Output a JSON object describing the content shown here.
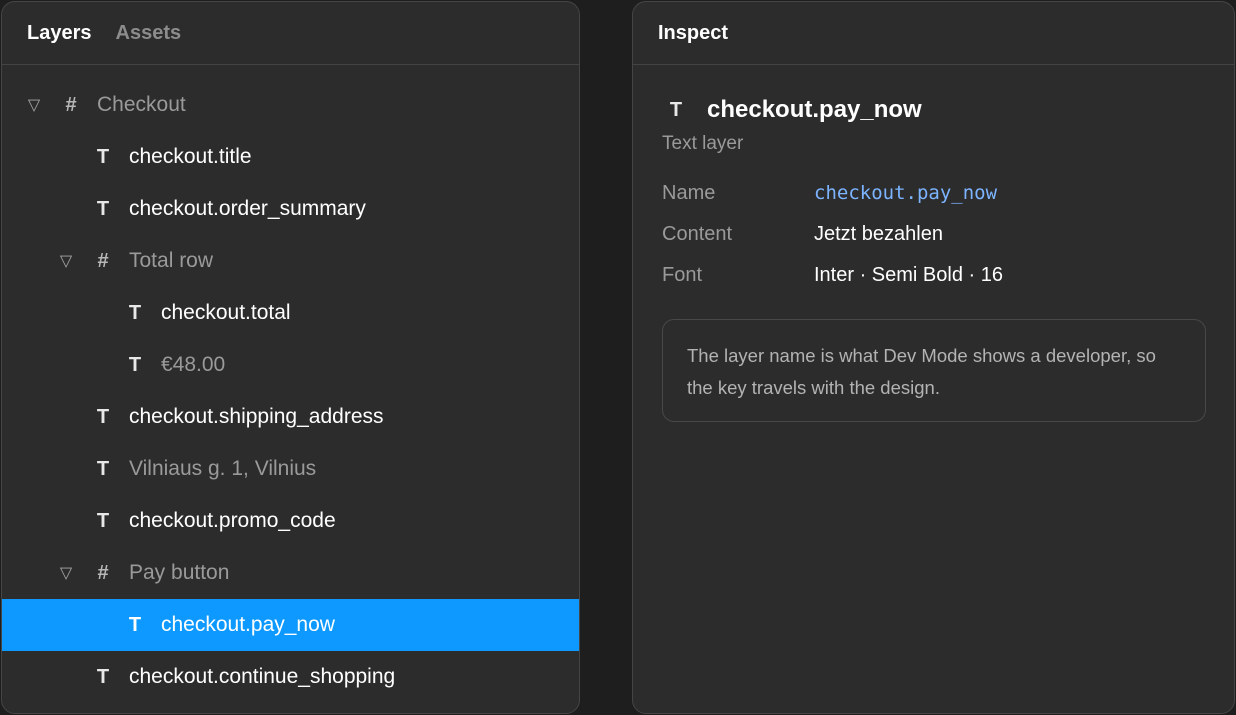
{
  "layers_panel": {
    "tabs": [
      {
        "label": "Layers",
        "active": true
      },
      {
        "label": "Assets",
        "active": false
      }
    ],
    "tree": [
      {
        "type": "frame",
        "label": "Checkout",
        "depth": 0,
        "expanded": true,
        "style": "muted"
      },
      {
        "type": "text",
        "label": "checkout.title",
        "depth": 1,
        "style": "key"
      },
      {
        "type": "text",
        "label": "checkout.order_summary",
        "depth": 1,
        "style": "key"
      },
      {
        "type": "frame",
        "label": "Total row",
        "depth": 1,
        "expanded": true,
        "style": "muted"
      },
      {
        "type": "text",
        "label": "checkout.total",
        "depth": 2,
        "style": "key"
      },
      {
        "type": "text",
        "label": "€48.00",
        "depth": 2,
        "style": "muted"
      },
      {
        "type": "text",
        "label": "checkout.shipping_address",
        "depth": 1,
        "style": "key"
      },
      {
        "type": "text",
        "label": "Vilniaus g. 1, Vilnius",
        "depth": 1,
        "style": "muted"
      },
      {
        "type": "text",
        "label": "checkout.promo_code",
        "depth": 1,
        "style": "key"
      },
      {
        "type": "frame",
        "label": "Pay button",
        "depth": 1,
        "expanded": true,
        "style": "muted"
      },
      {
        "type": "text",
        "label": "checkout.pay_now",
        "depth": 2,
        "style": "key",
        "selected": true
      },
      {
        "type": "text",
        "label": "checkout.continue_shopping",
        "depth": 1,
        "style": "key"
      }
    ]
  },
  "inspect_panel": {
    "title": "Inspect",
    "layer_type_glyph": "T",
    "layer_name": "checkout.pay_now",
    "layer_kind": "Text layer",
    "properties": [
      {
        "label": "Name",
        "value": "checkout.pay_now",
        "mono": true
      },
      {
        "label": "Content",
        "value": "Jetzt bezahlen",
        "mono": false
      },
      {
        "label": "Font",
        "value": "Inter · Semi Bold · 16",
        "mono": false
      }
    ],
    "note": "The layer name is what Dev Mode shows a developer, so the key travels with the design."
  },
  "glyphs": {
    "caret": "▽",
    "frame": "#",
    "text": "T"
  },
  "colors": {
    "selection": "#0d99ff",
    "mono_value": "#7cb4ff",
    "panel_bg": "#2c2c2c",
    "app_bg": "#1e1e1e"
  }
}
